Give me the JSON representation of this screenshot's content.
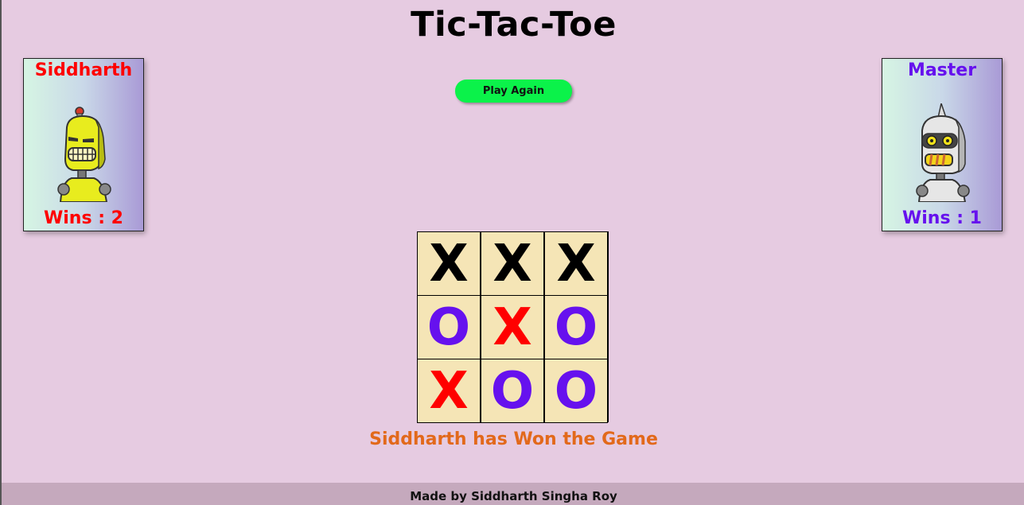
{
  "title": "Tic-Tac-Toe",
  "play_again_label": "Play Again",
  "players": {
    "left": {
      "name": "Siddharth",
      "wins": "Wins : 2",
      "color": "#ff0000",
      "avatar_icon": "yellow-robot-icon"
    },
    "right": {
      "name": "Master",
      "wins": "Wins : 1",
      "color": "#6611ee",
      "avatar_icon": "white-robot-icon"
    }
  },
  "board": {
    "cells": [
      "X",
      "X",
      "X",
      "O",
      "X",
      "O",
      "X",
      "O",
      "O"
    ],
    "cell_colors": [
      "#000000",
      "#000000",
      "#000000",
      "#6611ee",
      "#ff0000",
      "#6611ee",
      "#ff0000",
      "#6611ee",
      "#6611ee"
    ]
  },
  "result_message": "Siddharth has Won the Game",
  "footer": "Made by Siddharth Singha Roy"
}
